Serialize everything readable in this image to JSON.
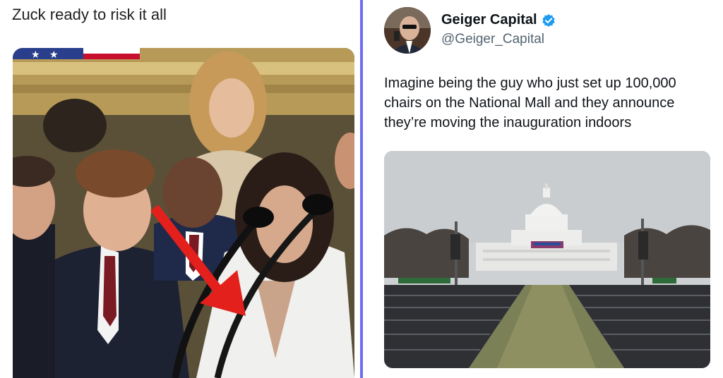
{
  "left_post": {
    "caption": "Zuck ready to risk it all"
  },
  "tweet": {
    "display_name": "Geiger Capital",
    "handle": "@Geiger_Capital",
    "text": "Imagine being the guy who just set up 100,000 chairs on the National Mall and they announce they’re moving the inauguration indoors"
  },
  "colors": {
    "divider": "#6f6cf2",
    "verified": "#1d9bf0",
    "arrow": "#e3201b"
  },
  "icons": {
    "verified": "verified-badge-icon",
    "arrow": "red-arrow-annotation"
  }
}
